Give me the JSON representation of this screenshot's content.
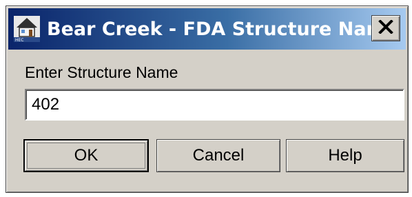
{
  "dialog": {
    "title": "Bear Creek - FDA Structure Name",
    "icon": "house-icon",
    "close_icon": "close-icon"
  },
  "form": {
    "prompt_label": "Enter Structure Name",
    "structure_name_value": "402"
  },
  "buttons": {
    "ok_label": "OK",
    "cancel_label": "Cancel",
    "help_label": "Help"
  },
  "colors": {
    "titlebar_start": "#0a246a",
    "titlebar_end": "#a6caf0",
    "window_face": "#d4d0c8"
  }
}
